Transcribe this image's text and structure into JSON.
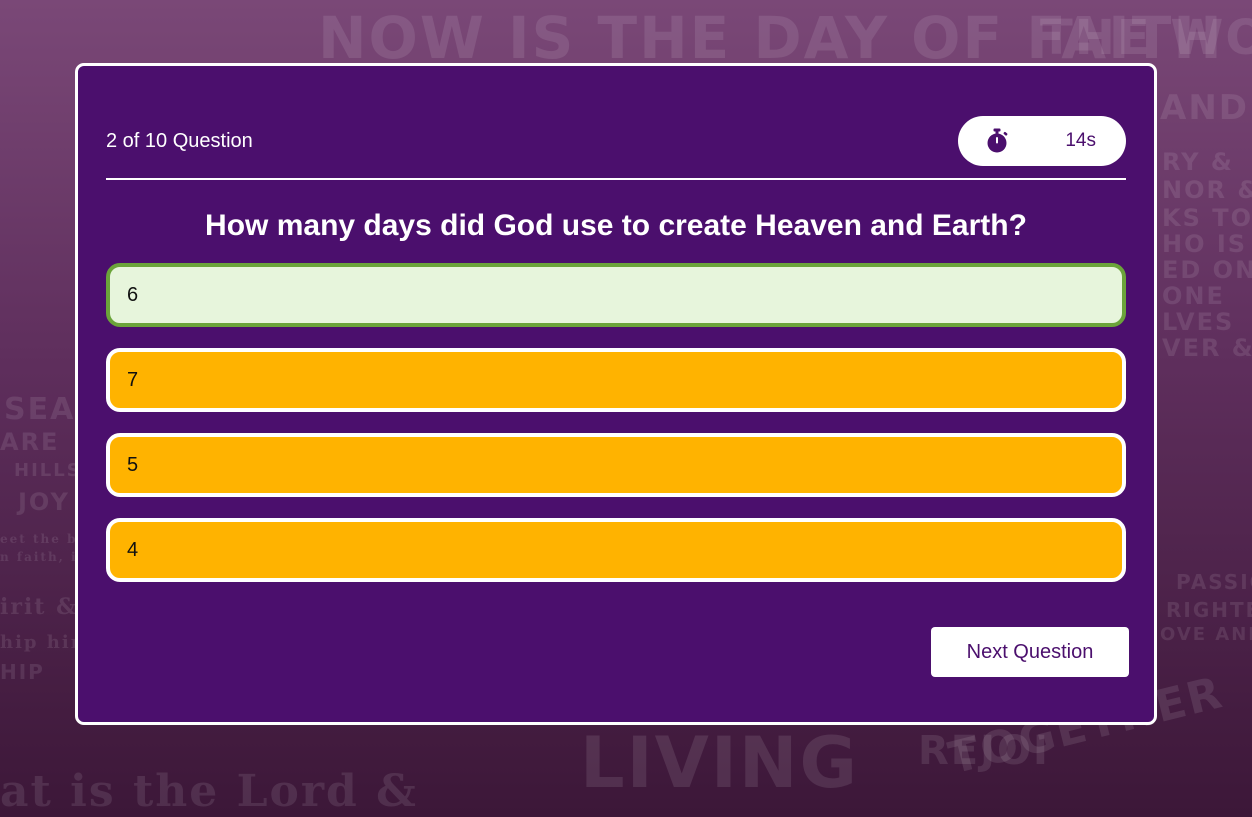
{
  "background": {
    "lines": [
      "NOW IS THE DAY OF FAITH",
      "THE WO",
      "AND I",
      "RY &",
      "NOR &",
      "KS TO",
      "HO IS",
      "ED ON",
      "ONE",
      "LVES",
      "VER &",
      "SEA",
      "ARE",
      "HILLS",
      "JOY",
      "eet the believers",
      "n faith, in purity",
      "irit &",
      "hip him",
      "HIP",
      "PASSIO",
      "RIGHTE",
      "OVE AND",
      "at is the Lord &",
      "LIVING",
      "REJOI",
      "TOGETHER"
    ]
  },
  "quiz": {
    "counter": "2 of 10 Question",
    "timer_icon": "stopwatch-icon",
    "timer_value": "14s",
    "question": "How many days did God use to create Heaven and Earth?",
    "options": [
      {
        "label": "6",
        "state": "correct"
      },
      {
        "label": "7",
        "state": "default"
      },
      {
        "label": "5",
        "state": "default"
      },
      {
        "label": "4",
        "state": "default"
      }
    ],
    "next_label": "Next Question"
  },
  "colors": {
    "card": "#4b0f6d",
    "option": "#ffb300",
    "correct_bg": "#e7f5dc",
    "correct_border": "#6ba43a"
  }
}
